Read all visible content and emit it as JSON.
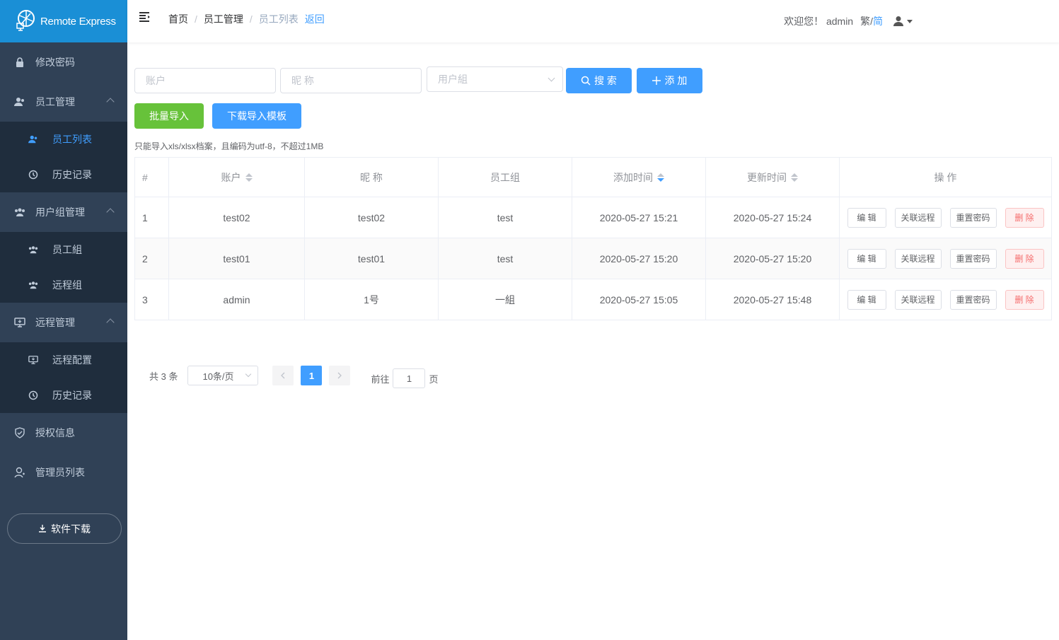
{
  "app": {
    "name": "Remote Express"
  },
  "sidebar": {
    "items": [
      {
        "label": "修改密码",
        "icon": "lock-icon"
      },
      {
        "label": "员工管理",
        "icon": "user-icon",
        "expanded": true,
        "children": [
          {
            "label": "员工列表",
            "icon": "users-icon",
            "active": true
          },
          {
            "label": "历史记录",
            "icon": "history-icon"
          }
        ]
      },
      {
        "label": "用户组管理",
        "icon": "group-icon",
        "expanded": true,
        "children": [
          {
            "label": "员工組",
            "icon": "group-icon"
          },
          {
            "label": "远程组",
            "icon": "group-icon"
          }
        ]
      },
      {
        "label": "远程管理",
        "icon": "monitor-icon",
        "expanded": true,
        "children": [
          {
            "label": "远程配置",
            "icon": "monitor-icon"
          },
          {
            "label": "历史记录",
            "icon": "history-icon"
          }
        ]
      },
      {
        "label": "授权信息",
        "icon": "shield-icon"
      },
      {
        "label": "管理员列表",
        "icon": "admin-icon"
      }
    ],
    "download_label": "软件下载"
  },
  "header": {
    "breadcrumb": [
      "首页",
      "员工管理",
      "员工列表"
    ],
    "back_label": "返回",
    "welcome": "欢迎您！ admin",
    "lang_trad": "繁/",
    "lang_simp": "简"
  },
  "filters": {
    "account_placeholder": "账户",
    "nickname_placeholder": "昵 称",
    "group_placeholder": "用户組",
    "search_label": "搜 索",
    "add_label": "添 加",
    "import_label": "批量导入",
    "template_label": "下载导入模板",
    "hint": "只能导入xls/xlsx档案，且编码为utf-8，不超过1MB"
  },
  "table": {
    "columns": [
      "#",
      "账户",
      "昵 称",
      "员工组",
      "添加时间",
      "更新时间",
      "操 作"
    ],
    "rows": [
      {
        "idx": "1",
        "account": "test02",
        "nickname": "test02",
        "group": "test",
        "added": "2020-05-27 15:21",
        "updated": "2020-05-27 15:24"
      },
      {
        "idx": "2",
        "account": "test01",
        "nickname": "test01",
        "group": "test",
        "added": "2020-05-27 15:20",
        "updated": "2020-05-27 15:20"
      },
      {
        "idx": "3",
        "account": "admin",
        "nickname": "1号",
        "group": "一組",
        "added": "2020-05-27 15:05",
        "updated": "2020-05-27 15:48"
      }
    ],
    "actions": {
      "edit": "编 辑",
      "link": "关联远程",
      "reset": "重置密码",
      "delete": "删 除"
    }
  },
  "pagination": {
    "total": "共 3 条",
    "page_size": "10条/页",
    "current_page": "1",
    "goto_prefix": "前往",
    "goto_value": "1",
    "goto_suffix": "页"
  },
  "colors": {
    "accent": "#409eff",
    "sidebar_bg": "#304156",
    "submenu_bg": "#1f2d3d",
    "logo_bg": "#1a8fd6",
    "success": "#67c23a",
    "danger": "#f56c6c"
  }
}
